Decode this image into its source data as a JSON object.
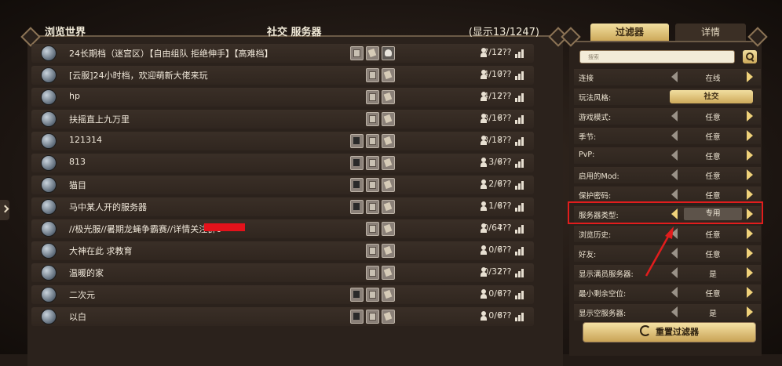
{
  "header": {
    "browse_title": "浏览世界",
    "server_title": "社交 服务器",
    "count_display": "(显示13/1247)"
  },
  "servers": [
    {
      "name": "24长期档（迷宫区）【自由组队  拒绝伸手】【高难档】",
      "players": "7/12",
      "ping": "???",
      "icons": [
        "scroll",
        "scroll2",
        "skull"
      ]
    },
    {
      "name": "[云服]24小时档，欢迎萌新大佬来玩",
      "players": "4/10",
      "ping": "???",
      "icons": [
        "scroll",
        "scroll2"
      ]
    },
    {
      "name": "hp",
      "players": "4/12",
      "ping": "???",
      "icons": [
        "scroll",
        "scroll2"
      ]
    },
    {
      "name": "扶摇直上九万里",
      "players": "3/16",
      "ping": "???",
      "icons": [
        "scroll",
        "scroll2"
      ]
    },
    {
      "name": "121314",
      "players": "3/18",
      "ping": "???",
      "icons": [
        "lantern",
        "scroll",
        "scroll2"
      ]
    },
    {
      "name": "813",
      "players": "3/6",
      "ping": "???",
      "icons": [
        "lantern",
        "scroll",
        "scroll2"
      ]
    },
    {
      "name": "猫目",
      "players": "2/6",
      "ping": "???",
      "icons": [
        "lantern",
        "scroll",
        "scroll2"
      ]
    },
    {
      "name": "马中某人开的服务器",
      "players": "1/6",
      "ping": "???",
      "icons": [
        "lantern",
        "scroll",
        "scroll2"
      ]
    },
    {
      "name": "//极光服//暑期龙蝇争霸赛//详情关注群6",
      "players": "0/64",
      "ping": "???",
      "icons": [
        "scroll",
        "scroll2"
      ]
    },
    {
      "name": "大神在此  求教育",
      "players": "0/6",
      "ping": "???",
      "icons": [
        "scroll",
        "scroll2"
      ]
    },
    {
      "name": "温暖的家",
      "players": "0/32",
      "ping": "???",
      "icons": [
        "scroll",
        "scroll2"
      ]
    },
    {
      "name": "二次元",
      "players": "0/6",
      "ping": "???",
      "icons": [
        "lantern",
        "scroll",
        "scroll2"
      ]
    },
    {
      "name": "以白",
      "players": "0/6",
      "ping": "???",
      "icons": [
        "lantern",
        "scroll",
        "scroll2"
      ]
    }
  ],
  "tabs": {
    "filter": "过滤器",
    "details": "详情"
  },
  "search": {
    "placeholder": "搜索"
  },
  "filters": [
    {
      "label": "连接",
      "value": "在线"
    },
    {
      "label": "玩法风格:",
      "value": "社交"
    },
    {
      "label": "游戏模式:",
      "value": "任意"
    },
    {
      "label": "季节:",
      "value": "任意"
    },
    {
      "label": "PvP:",
      "value": "任意"
    },
    {
      "label": "启用的Mod:",
      "value": "任意"
    },
    {
      "label": "保护密码:",
      "value": "任意"
    },
    {
      "label": "服务器类型:",
      "value": "专用"
    },
    {
      "label": "浏览历史:",
      "value": "任意"
    },
    {
      "label": "好友:",
      "value": "任意"
    },
    {
      "label": "显示满员服务器:",
      "value": "是"
    },
    {
      "label": "最小剩余空位:",
      "value": "任意"
    },
    {
      "label": "显示空服务器:",
      "value": "是"
    }
  ],
  "reset_label": "重置过滤器",
  "colors": {
    "highlight": "#e11d1d",
    "accent_gold": "#f0d27a"
  }
}
